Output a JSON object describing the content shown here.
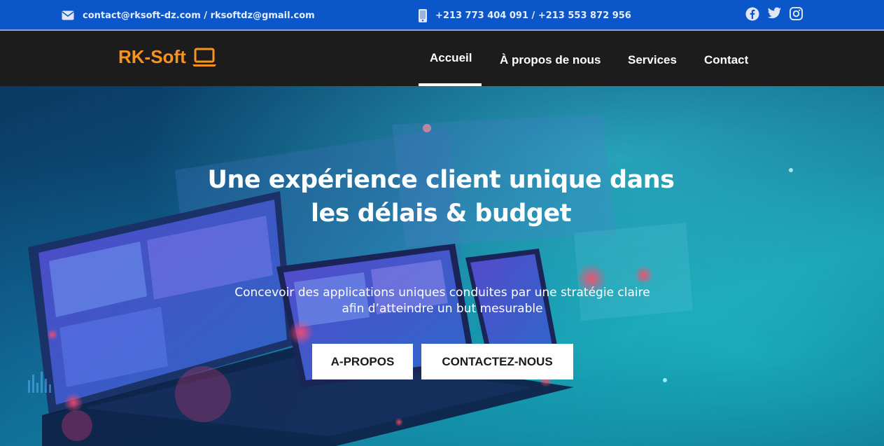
{
  "topbar": {
    "email": "contact@rksoft-dz.com / rksoftdz@gmail.com",
    "phone": "+213 773 404 091 / +213 553 872 956",
    "social": [
      "facebook-icon",
      "twitter-icon",
      "instagram-icon"
    ]
  },
  "navbar": {
    "brand": "RK-Soft",
    "brand_icon": "laptop-icon",
    "links": [
      {
        "label": "Accueil",
        "active": true
      },
      {
        "label": "À propos de nous"
      },
      {
        "label": "Services"
      },
      {
        "label": "Contact"
      }
    ]
  },
  "hero": {
    "title_line1": "Une expérience client unique dans",
    "title_line2": "les délais & budget",
    "subtitle_line1": "Concevoir des applications uniques conduites par une stratégie claire",
    "subtitle_line2": "afin d’atteindre un but mesurable",
    "buttons": [
      {
        "label": "A-PROPOS"
      },
      {
        "label": "CONTACTEZ-NOUS"
      }
    ]
  },
  "colors": {
    "topbar": "#0b57c9",
    "navbar": "#1c1c1c",
    "brand": "#f7931e",
    "button_bg": "#ffffff"
  }
}
